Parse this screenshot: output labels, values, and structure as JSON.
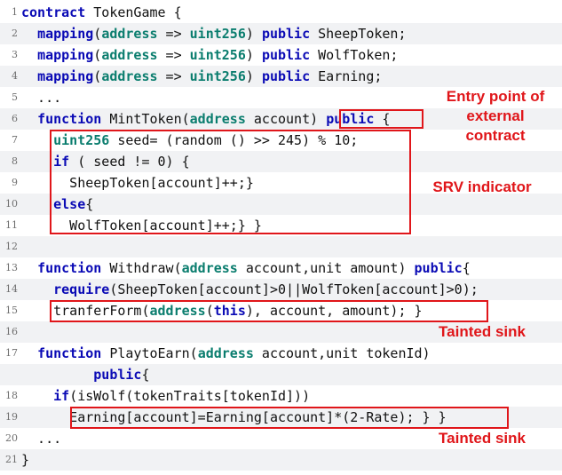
{
  "code_lines": [
    {
      "num": "1",
      "segments": [
        {
          "kind": "kw",
          "text": "contract"
        },
        {
          "kind": "plain",
          "text": " TokenGame {"
        }
      ]
    },
    {
      "num": "2",
      "segments": [
        {
          "kind": "plain",
          "text": "  "
        },
        {
          "kind": "kw",
          "text": "mapping"
        },
        {
          "kind": "plain",
          "text": "("
        },
        {
          "kind": "ty",
          "text": "address"
        },
        {
          "kind": "plain",
          "text": " => "
        },
        {
          "kind": "ty",
          "text": "uint256"
        },
        {
          "kind": "plain",
          "text": ") "
        },
        {
          "kind": "kw",
          "text": "public"
        },
        {
          "kind": "plain",
          "text": " SheepToken;"
        }
      ]
    },
    {
      "num": "3",
      "segments": [
        {
          "kind": "plain",
          "text": "  "
        },
        {
          "kind": "kw",
          "text": "mapping"
        },
        {
          "kind": "plain",
          "text": "("
        },
        {
          "kind": "ty",
          "text": "address"
        },
        {
          "kind": "plain",
          "text": " => "
        },
        {
          "kind": "ty",
          "text": "uint256"
        },
        {
          "kind": "plain",
          "text": ") "
        },
        {
          "kind": "kw",
          "text": "public"
        },
        {
          "kind": "plain",
          "text": " WolfToken;"
        }
      ]
    },
    {
      "num": "4",
      "segments": [
        {
          "kind": "plain",
          "text": "  "
        },
        {
          "kind": "kw",
          "text": "mapping"
        },
        {
          "kind": "plain",
          "text": "("
        },
        {
          "kind": "ty",
          "text": "address"
        },
        {
          "kind": "plain",
          "text": " => "
        },
        {
          "kind": "ty",
          "text": "uint256"
        },
        {
          "kind": "plain",
          "text": ") "
        },
        {
          "kind": "kw",
          "text": "public"
        },
        {
          "kind": "plain",
          "text": " Earning;"
        }
      ]
    },
    {
      "num": "5",
      "segments": [
        {
          "kind": "plain",
          "text": "  ..."
        }
      ]
    },
    {
      "num": "6",
      "segments": [
        {
          "kind": "plain",
          "text": "  "
        },
        {
          "kind": "kw",
          "text": "function"
        },
        {
          "kind": "plain",
          "text": " MintToken("
        },
        {
          "kind": "ty",
          "text": "address"
        },
        {
          "kind": "plain",
          "text": " account) "
        },
        {
          "kind": "kw",
          "text": "public"
        },
        {
          "kind": "plain",
          "text": " {"
        }
      ]
    },
    {
      "num": "7",
      "segments": [
        {
          "kind": "plain",
          "text": "    "
        },
        {
          "kind": "ty",
          "text": "uint256"
        },
        {
          "kind": "plain",
          "text": " seed= (random () >> 245) % 10;"
        }
      ]
    },
    {
      "num": "8",
      "segments": [
        {
          "kind": "plain",
          "text": "    "
        },
        {
          "kind": "kw",
          "text": "if"
        },
        {
          "kind": "plain",
          "text": " ( seed != 0) {"
        }
      ]
    },
    {
      "num": "9",
      "segments": [
        {
          "kind": "plain",
          "text": "      SheepToken[account]++;}"
        }
      ]
    },
    {
      "num": "10",
      "segments": [
        {
          "kind": "plain",
          "text": "    "
        },
        {
          "kind": "kw",
          "text": "else"
        },
        {
          "kind": "plain",
          "text": "{"
        }
      ]
    },
    {
      "num": "11",
      "segments": [
        {
          "kind": "plain",
          "text": "      WolfToken[account]++;} }"
        }
      ]
    },
    {
      "num": "12",
      "segments": [
        {
          "kind": "plain",
          "text": ""
        }
      ]
    },
    {
      "num": "13",
      "segments": [
        {
          "kind": "plain",
          "text": "  "
        },
        {
          "kind": "kw",
          "text": "function"
        },
        {
          "kind": "plain",
          "text": " Withdraw("
        },
        {
          "kind": "ty",
          "text": "address"
        },
        {
          "kind": "plain",
          "text": " account,unit amount) "
        },
        {
          "kind": "kw",
          "text": "public"
        },
        {
          "kind": "plain",
          "text": "{"
        }
      ]
    },
    {
      "num": "14",
      "segments": [
        {
          "kind": "plain",
          "text": "    "
        },
        {
          "kind": "kw",
          "text": "require"
        },
        {
          "kind": "plain",
          "text": "(SheepToken[account]>0||WolfToken[account]>0);"
        }
      ]
    },
    {
      "num": "15",
      "segments": [
        {
          "kind": "plain",
          "text": "    tranferForm("
        },
        {
          "kind": "ty",
          "text": "address"
        },
        {
          "kind": "plain",
          "text": "("
        },
        {
          "kind": "kw",
          "text": "this"
        },
        {
          "kind": "plain",
          "text": "), account, amount); }"
        }
      ]
    },
    {
      "num": "16",
      "segments": [
        {
          "kind": "plain",
          "text": ""
        }
      ]
    },
    {
      "num": "17",
      "segments": [
        {
          "kind": "plain",
          "text": "  "
        },
        {
          "kind": "kw",
          "text": "function"
        },
        {
          "kind": "plain",
          "text": " PlaytoEarn("
        },
        {
          "kind": "ty",
          "text": "address"
        },
        {
          "kind": "plain",
          "text": " account,unit tokenId)"
        }
      ]
    },
    {
      "num": "",
      "segments": [
        {
          "kind": "plain",
          "text": "         "
        },
        {
          "kind": "kw",
          "text": "public"
        },
        {
          "kind": "plain",
          "text": "{"
        }
      ]
    },
    {
      "num": "18",
      "segments": [
        {
          "kind": "plain",
          "text": "    "
        },
        {
          "kind": "kw",
          "text": "if"
        },
        {
          "kind": "plain",
          "text": "(isWolf(tokenTraits[tokenId]))"
        }
      ]
    },
    {
      "num": "19",
      "segments": [
        {
          "kind": "plain",
          "text": "      Earning[account]=Earning[account]*(2-Rate); } }"
        }
      ]
    },
    {
      "num": "20",
      "segments": [
        {
          "kind": "plain",
          "text": "  ..."
        }
      ]
    },
    {
      "num": "21",
      "segments": [
        {
          "kind": "plain",
          "text": "}"
        }
      ]
    }
  ],
  "annotations": {
    "entry_point": "Entry point of\nexternal\ncontract",
    "srv_indicator": "SRV indicator",
    "tainted_sink_1": "Tainted sink",
    "tainted_sink_2": "Tainted sink"
  },
  "colors": {
    "keyword": "#0a0ab5",
    "type": "#0a7d6e",
    "highlight": "#e0161a",
    "shade": "#f1f2f4"
  }
}
